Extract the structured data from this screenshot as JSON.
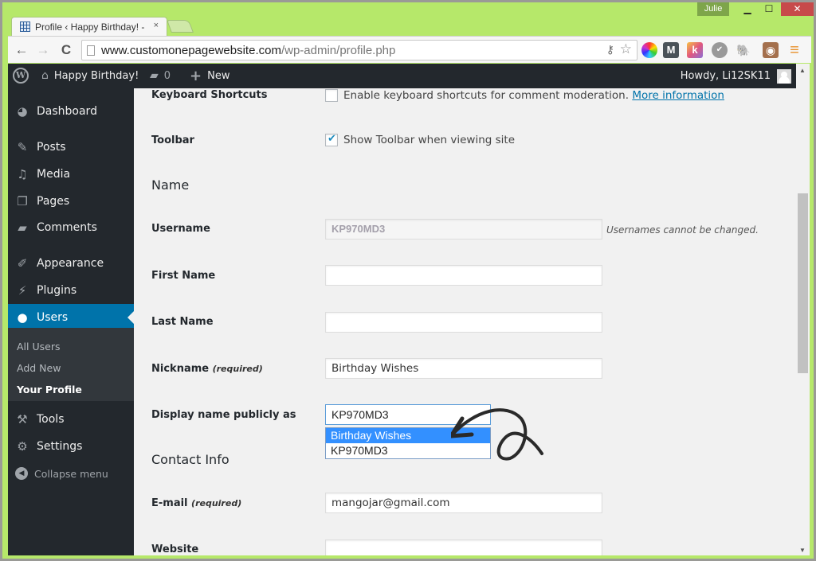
{
  "browser": {
    "tab_title": "Profile ‹ Happy Birthday! -",
    "tab_close": "×",
    "profile_name": "Julie",
    "window_controls": {
      "minimize": "▁",
      "maximize": "☐",
      "close": "✕"
    },
    "nav": {
      "back": "←",
      "forward": "→",
      "reload": "C"
    },
    "url_host": "www.customonepagewebsite.com",
    "url_path": "/wp-admin/profile.php",
    "key_icon": "⚷",
    "star_icon": "☆",
    "extensions": [
      {
        "name": "color-wheel-extension-icon",
        "glyph": "",
        "color": "#e33"
      },
      {
        "name": "m-extension-icon",
        "glyph": "M",
        "color": "#4a5258"
      },
      {
        "name": "k-extension-icon",
        "glyph": "k",
        "color": "#f0a04b"
      },
      {
        "name": "check-extension-icon",
        "glyph": "✔",
        "color": "#888"
      },
      {
        "name": "evernote-extension-icon",
        "glyph": "🐘",
        "color": "#555"
      },
      {
        "name": "instagram-extension-icon",
        "glyph": "◉",
        "color": "#a4704d"
      },
      {
        "name": "menu-icon",
        "glyph": "≡",
        "color": "#e8902a"
      }
    ]
  },
  "adminbar": {
    "wp_logo": "W",
    "site_name": "Happy Birthday!",
    "comments_count": "0",
    "new_label": "New",
    "howdy": "Howdy, Li12SK11"
  },
  "sidebar": {
    "items": [
      {
        "label": "Dashboard",
        "icon": "dashboard-icon",
        "glyph": "◕"
      },
      {
        "label": "Posts",
        "icon": "pin-icon",
        "glyph": "✎"
      },
      {
        "label": "Media",
        "icon": "media-icon",
        "glyph": "♫"
      },
      {
        "label": "Pages",
        "icon": "pages-icon",
        "glyph": "❐"
      },
      {
        "label": "Comments",
        "icon": "comment-icon",
        "glyph": "▰"
      },
      {
        "label": "Appearance",
        "icon": "paintbrush-icon",
        "glyph": "✐"
      },
      {
        "label": "Plugins",
        "icon": "plug-icon",
        "glyph": "⚡"
      },
      {
        "label": "Users",
        "icon": "user-icon",
        "glyph": "👤"
      },
      {
        "label": "Tools",
        "icon": "wrench-icon",
        "glyph": "🔧"
      },
      {
        "label": "Settings",
        "icon": "settings-icon",
        "glyph": "⚙"
      }
    ],
    "submenu": [
      "All Users",
      "Add New",
      "Your Profile"
    ],
    "collapse_label": "Collapse menu",
    "collapse_glyph": "◀"
  },
  "form": {
    "keyboard_shortcuts": {
      "label": "Keyboard Shortcuts",
      "checked": false,
      "text": "Enable keyboard shortcuts for comment moderation.",
      "link": "More information"
    },
    "toolbar": {
      "label": "Toolbar",
      "checked": true,
      "text": "Show Toolbar when viewing site"
    },
    "name_section": "Name",
    "username": {
      "label": "Username",
      "value": "KP970MD3",
      "note": "Usernames cannot be changed."
    },
    "first_name": {
      "label": "First Name",
      "value": ""
    },
    "last_name": {
      "label": "Last Name",
      "value": ""
    },
    "nickname": {
      "label": "Nickname",
      "required": "(required)",
      "value": "Birthday Wishes"
    },
    "display_name": {
      "label": "Display name publicly as",
      "selected": "KP970MD3",
      "options": [
        "Birthday Wishes",
        "KP970MD3"
      ],
      "highlighted": "Birthday Wishes"
    },
    "contact_section": "Contact Info",
    "email": {
      "label": "E-mail",
      "required": "(required)",
      "value": "mangojar@gmail.com"
    },
    "website": {
      "label": "Website",
      "value": ""
    }
  },
  "scrollbar": {
    "up": "▲",
    "down": "▼"
  }
}
